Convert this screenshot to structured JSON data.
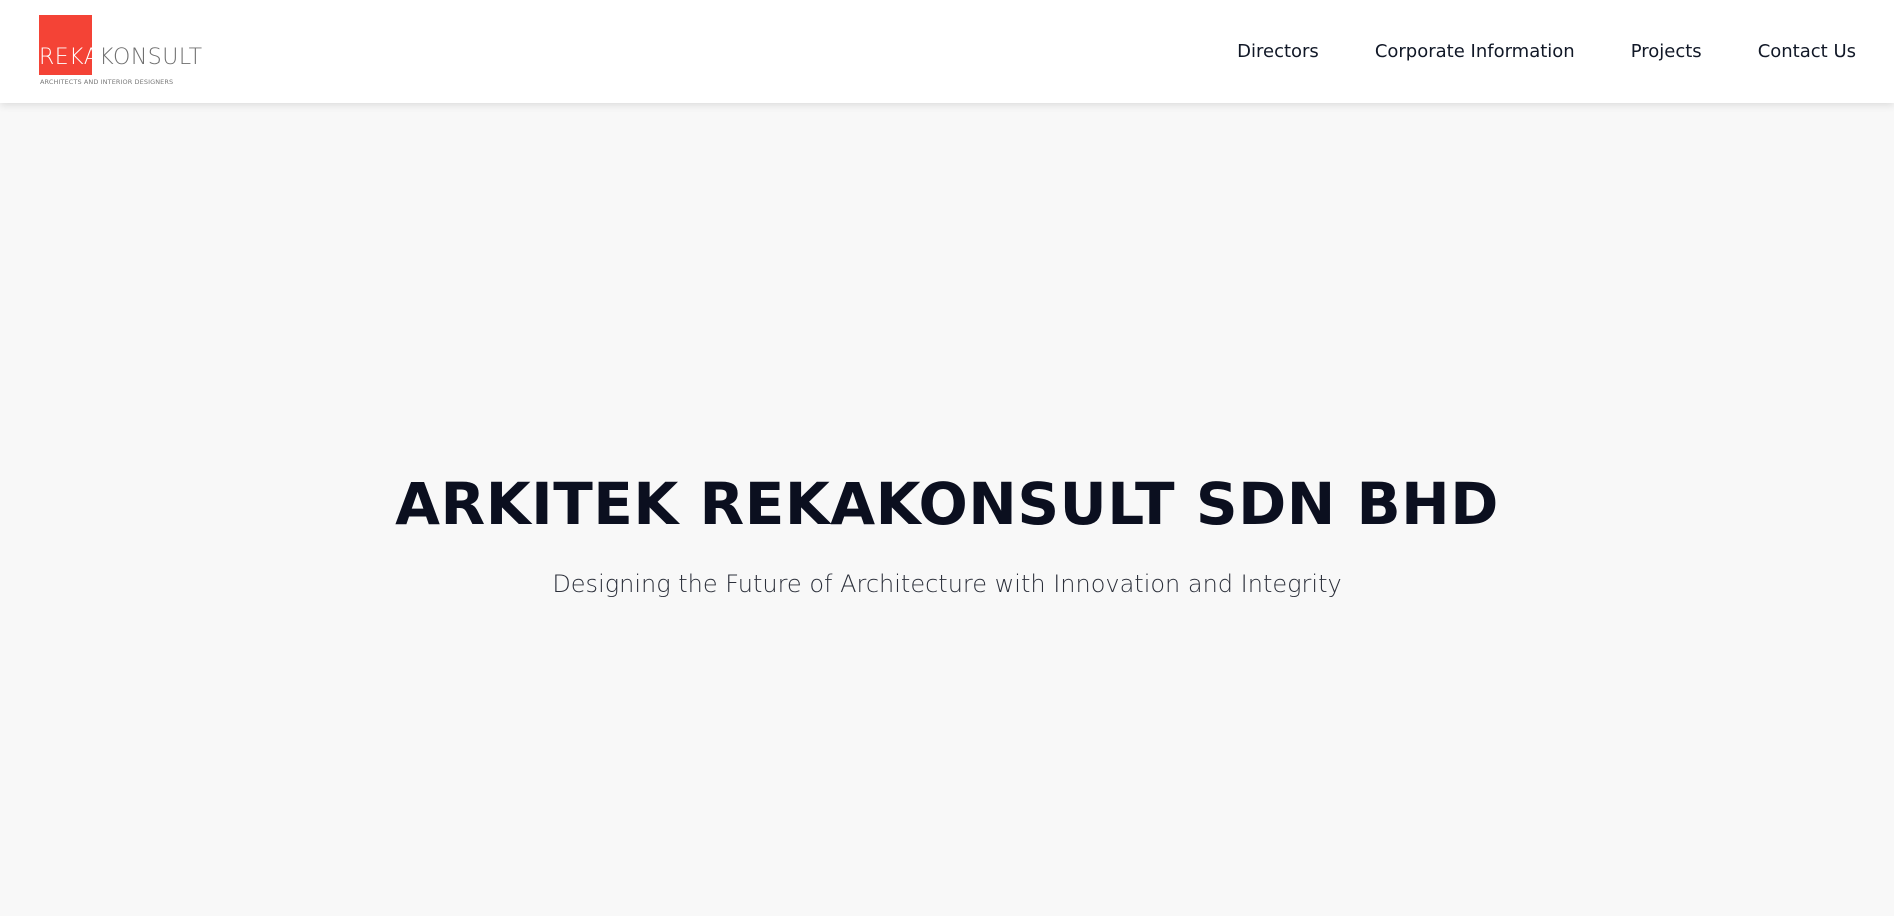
{
  "logo": {
    "brand_part1": "REKA",
    "brand_part2": "KONSULT",
    "tagline": "ARCHITECTS AND INTERIOR DESIGNERS",
    "accent_color": "#f44336"
  },
  "nav": {
    "items": [
      {
        "label": "Directors"
      },
      {
        "label": "Corporate Information"
      },
      {
        "label": "Projects"
      },
      {
        "label": "Contact Us"
      }
    ]
  },
  "hero": {
    "title": "ARKITEK REKAKONSULT SDN BHD",
    "subtitle": "Designing the Future of Architecture with Innovation and Integrity"
  }
}
